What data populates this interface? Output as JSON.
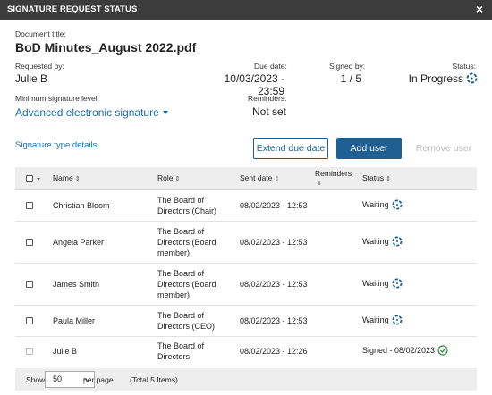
{
  "dialog": {
    "title": "SIGNATURE REQUEST STATUS",
    "close_label": "×"
  },
  "document": {
    "title_label": "Document title:",
    "title": "BoD Minutes_August 2022.pdf"
  },
  "info": {
    "requested_by_label": "Requested by:",
    "requested_by": "Julie B",
    "due_date_label": "Due date:",
    "due_date": "10/03/2023 - 23:59",
    "signed_by_label": "Signed by:",
    "signed_by": "1 / 5",
    "status_label": "Status:",
    "status": "In Progress",
    "min_sig_label": "Minimum signature level:",
    "min_sig": "Advanced electronic signature",
    "reminders_label": "Reminders:",
    "reminders": "Not set"
  },
  "actions": {
    "signature_type_link": "Signature type details",
    "extend_due_date": "Extend due date",
    "add_user": "Add user",
    "remove_user": "Remove user"
  },
  "table": {
    "headers": {
      "name": "Name",
      "role": "Role",
      "sent_date": "Sent date",
      "reminders": "Reminders",
      "status": "Status"
    },
    "rows": [
      {
        "name": "Christian Bloom",
        "role": "The Board of Directors (Chair)",
        "sent_date": "08/02/2023 - 12:53",
        "reminders": "",
        "status": "Waiting",
        "state": "waiting"
      },
      {
        "name": "Angela Parker",
        "role": "The Board of Directors (Board member)",
        "sent_date": "08/02/2023 - 12:53",
        "reminders": "",
        "status": "Waiting",
        "state": "waiting"
      },
      {
        "name": "James Smith",
        "role": "The Board of Directors (Board member)",
        "sent_date": "08/02/2023 - 12:53",
        "reminders": "",
        "status": "Waiting",
        "state": "waiting"
      },
      {
        "name": "Paula Miller",
        "role": "The Board of Directors (CEO)",
        "sent_date": "08/02/2023 - 12:53",
        "reminders": "",
        "status": "Waiting",
        "state": "waiting"
      },
      {
        "name": "Julie B",
        "role": "The Board of Directors",
        "sent_date": "08/02/2023 - 12:26",
        "reminders": "",
        "status": "Signed - 08/02/2023",
        "state": "signed"
      }
    ]
  },
  "pagination": {
    "show_label": "Show",
    "page_size": "50",
    "per_page_label": "per page",
    "total_label": "(Total 5 Items)"
  },
  "colors": {
    "header_bar": "#3c3c3c",
    "accent": "#1e5f94",
    "link": "#1e6aa8",
    "signed": "#2e8b3a",
    "pending_icon": "#1e5f94"
  }
}
